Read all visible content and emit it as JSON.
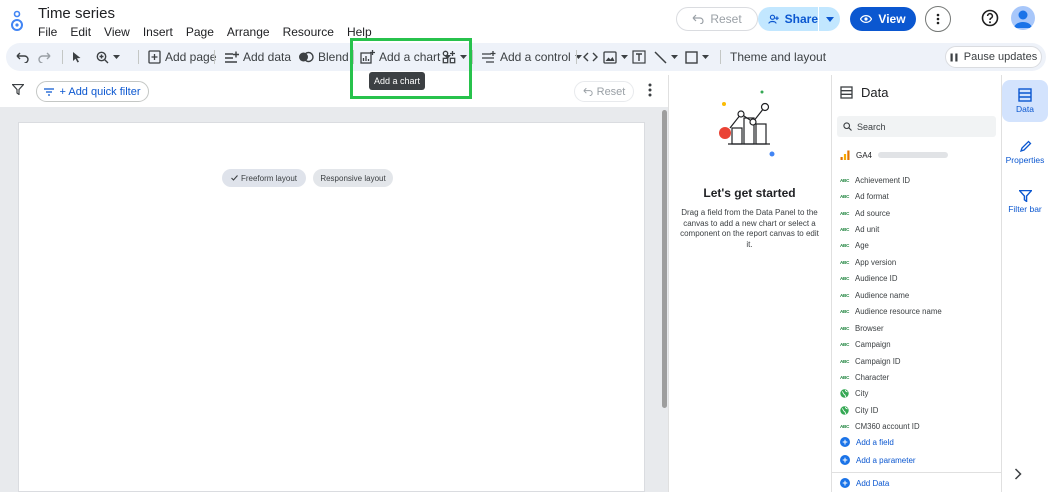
{
  "header": {
    "title": "Time series",
    "menus": [
      "File",
      "Edit",
      "View",
      "Insert",
      "Page",
      "Arrange",
      "Resource",
      "Help"
    ],
    "reset_label": "Reset",
    "share_label": "Share",
    "view_label": "View"
  },
  "toolbar": {
    "add_page": "Add page",
    "add_data": "Add data",
    "blend": "Blend",
    "add_chart": "Add a chart",
    "add_control": "Add a control",
    "theme_layout": "Theme and layout",
    "pause_updates": "Pause updates",
    "tooltip": "Add a chart"
  },
  "filterbar": {
    "quick_filter": "+ Add quick filter",
    "reset_label": "Reset"
  },
  "canvas": {
    "freeform": "Freeform layout",
    "responsive": "Responsive layout"
  },
  "properties": {
    "title": "Let's get started",
    "body": "Drag a field from the Data Panel to the canvas to add a new chart or select a component on the report canvas to edit it."
  },
  "data_panel": {
    "title": "Data",
    "search_placeholder": "Search",
    "source_name": "GA4",
    "fields": [
      {
        "type": "abc",
        "name": "Achievement ID"
      },
      {
        "type": "abc",
        "name": "Ad format"
      },
      {
        "type": "abc",
        "name": "Ad source"
      },
      {
        "type": "abc",
        "name": "Ad unit"
      },
      {
        "type": "abc",
        "name": "Age"
      },
      {
        "type": "abc",
        "name": "App version"
      },
      {
        "type": "abc",
        "name": "Audience ID"
      },
      {
        "type": "abc",
        "name": "Audience name"
      },
      {
        "type": "abc",
        "name": "Audience resource name"
      },
      {
        "type": "abc",
        "name": "Browser"
      },
      {
        "type": "abc",
        "name": "Campaign"
      },
      {
        "type": "abc",
        "name": "Campaign ID"
      },
      {
        "type": "abc",
        "name": "Character"
      },
      {
        "type": "geo",
        "name": "City"
      },
      {
        "type": "geo",
        "name": "City ID"
      },
      {
        "type": "abc",
        "name": "CM360 account ID"
      }
    ],
    "field_type_label": "ABC",
    "add_field": "Add a field",
    "add_parameter": "Add a parameter",
    "add_data": "Add Data"
  },
  "rail": {
    "data": "Data",
    "properties": "Properties",
    "filter_bar": "Filter bar"
  },
  "colors": {
    "accent": "#0b57d0",
    "share_bg": "#c2e7ff",
    "highlight": "#27c24c",
    "dimension_green": "#188038"
  }
}
